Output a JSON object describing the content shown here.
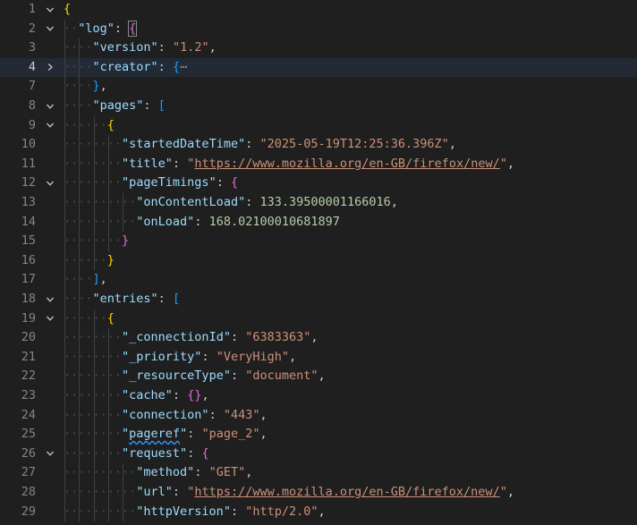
{
  "editor": {
    "lines": [
      {
        "num": "1",
        "fold": "down",
        "indent": 0,
        "parts": [
          {
            "t": "{",
            "c": "b1"
          }
        ]
      },
      {
        "num": "2",
        "fold": "down",
        "indent": 1,
        "parts": [
          {
            "t": "\"log\"",
            "c": "k"
          },
          {
            "t": ": ",
            "c": "p"
          },
          {
            "t": "{",
            "c": "b2",
            "box": true
          }
        ]
      },
      {
        "num": "3",
        "fold": "",
        "indent": 2,
        "parts": [
          {
            "t": "\"version\"",
            "c": "k"
          },
          {
            "t": ": ",
            "c": "p"
          },
          {
            "t": "\"1.2\"",
            "c": "s"
          },
          {
            "t": ",",
            "c": "p"
          }
        ]
      },
      {
        "num": "4",
        "fold": "right",
        "indent": 2,
        "current": true,
        "parts": [
          {
            "t": "\"creator\"",
            "c": "k"
          },
          {
            "t": ": ",
            "c": "p"
          },
          {
            "t": "{",
            "c": "b3"
          },
          {
            "t": "⋯",
            "c": "ellipsis"
          }
        ]
      },
      {
        "num": "7",
        "fold": "",
        "indent": 2,
        "parts": [
          {
            "t": "}",
            "c": "b3"
          },
          {
            "t": ",",
            "c": "p"
          }
        ]
      },
      {
        "num": "8",
        "fold": "down",
        "indent": 2,
        "parts": [
          {
            "t": "\"pages\"",
            "c": "k"
          },
          {
            "t": ": ",
            "c": "p"
          },
          {
            "t": "[",
            "c": "b3"
          }
        ]
      },
      {
        "num": "9",
        "fold": "down",
        "indent": 3,
        "parts": [
          {
            "t": "{",
            "c": "b1"
          }
        ]
      },
      {
        "num": "10",
        "fold": "",
        "indent": 4,
        "parts": [
          {
            "t": "\"startedDateTime\"",
            "c": "k"
          },
          {
            "t": ": ",
            "c": "p"
          },
          {
            "t": "\"2025-05-19T12:25:36.396Z\"",
            "c": "s"
          },
          {
            "t": ",",
            "c": "p"
          }
        ]
      },
      {
        "num": "11",
        "fold": "",
        "indent": 4,
        "parts": [
          {
            "t": "\"title\"",
            "c": "k"
          },
          {
            "t": ": ",
            "c": "p"
          },
          {
            "t": "\"",
            "c": "s"
          },
          {
            "t": "https://www.mozilla.org/en-GB/firefox/new/",
            "c": "s",
            "link": true
          },
          {
            "t": "\"",
            "c": "s"
          },
          {
            "t": ",",
            "c": "p"
          }
        ]
      },
      {
        "num": "12",
        "fold": "down",
        "indent": 4,
        "parts": [
          {
            "t": "\"pageTimings\"",
            "c": "k"
          },
          {
            "t": ": ",
            "c": "p"
          },
          {
            "t": "{",
            "c": "b2"
          }
        ]
      },
      {
        "num": "13",
        "fold": "",
        "indent": 5,
        "parts": [
          {
            "t": "\"onContentLoad\"",
            "c": "k"
          },
          {
            "t": ": ",
            "c": "p"
          },
          {
            "t": "133.39500001166016",
            "c": "n"
          },
          {
            "t": ",",
            "c": "p"
          }
        ]
      },
      {
        "num": "14",
        "fold": "",
        "indent": 5,
        "parts": [
          {
            "t": "\"onLoad\"",
            "c": "k"
          },
          {
            "t": ": ",
            "c": "p"
          },
          {
            "t": "168.02100010681897",
            "c": "n"
          }
        ]
      },
      {
        "num": "15",
        "fold": "",
        "indent": 4,
        "parts": [
          {
            "t": "}",
            "c": "b2"
          }
        ]
      },
      {
        "num": "16",
        "fold": "",
        "indent": 3,
        "parts": [
          {
            "t": "}",
            "c": "b1"
          }
        ]
      },
      {
        "num": "17",
        "fold": "",
        "indent": 2,
        "parts": [
          {
            "t": "]",
            "c": "b3"
          },
          {
            "t": ",",
            "c": "p"
          }
        ]
      },
      {
        "num": "18",
        "fold": "down",
        "indent": 2,
        "parts": [
          {
            "t": "\"entries\"",
            "c": "k"
          },
          {
            "t": ": ",
            "c": "p"
          },
          {
            "t": "[",
            "c": "b3"
          }
        ]
      },
      {
        "num": "19",
        "fold": "down",
        "indent": 3,
        "parts": [
          {
            "t": "{",
            "c": "b1"
          }
        ]
      },
      {
        "num": "20",
        "fold": "",
        "indent": 4,
        "parts": [
          {
            "t": "\"_connectionId\"",
            "c": "k"
          },
          {
            "t": ": ",
            "c": "p"
          },
          {
            "t": "\"6383363\"",
            "c": "s"
          },
          {
            "t": ",",
            "c": "p"
          }
        ]
      },
      {
        "num": "21",
        "fold": "",
        "indent": 4,
        "parts": [
          {
            "t": "\"_priority\"",
            "c": "k"
          },
          {
            "t": ": ",
            "c": "p"
          },
          {
            "t": "\"VeryHigh\"",
            "c": "s"
          },
          {
            "t": ",",
            "c": "p"
          }
        ]
      },
      {
        "num": "22",
        "fold": "",
        "indent": 4,
        "parts": [
          {
            "t": "\"_resourceType\"",
            "c": "k"
          },
          {
            "t": ": ",
            "c": "p"
          },
          {
            "t": "\"document\"",
            "c": "s"
          },
          {
            "t": ",",
            "c": "p"
          }
        ]
      },
      {
        "num": "23",
        "fold": "",
        "indent": 4,
        "parts": [
          {
            "t": "\"cache\"",
            "c": "k"
          },
          {
            "t": ": ",
            "c": "p"
          },
          {
            "t": "{}",
            "c": "b2"
          },
          {
            "t": ",",
            "c": "p"
          }
        ]
      },
      {
        "num": "24",
        "fold": "",
        "indent": 4,
        "parts": [
          {
            "t": "\"connection\"",
            "c": "k"
          },
          {
            "t": ": ",
            "c": "p"
          },
          {
            "t": "\"443\"",
            "c": "s"
          },
          {
            "t": ",",
            "c": "p"
          }
        ]
      },
      {
        "num": "25",
        "fold": "",
        "indent": 4,
        "parts": [
          {
            "t": "\"",
            "c": "k"
          },
          {
            "t": "pageref",
            "c": "k",
            "squiggle": true
          },
          {
            "t": "\"",
            "c": "k"
          },
          {
            "t": ": ",
            "c": "p"
          },
          {
            "t": "\"page_2\"",
            "c": "s"
          },
          {
            "t": ",",
            "c": "p"
          }
        ]
      },
      {
        "num": "26",
        "fold": "down",
        "indent": 4,
        "parts": [
          {
            "t": "\"request\"",
            "c": "k"
          },
          {
            "t": ": ",
            "c": "p"
          },
          {
            "t": "{",
            "c": "b2"
          }
        ]
      },
      {
        "num": "27",
        "fold": "",
        "indent": 5,
        "parts": [
          {
            "t": "\"method\"",
            "c": "k"
          },
          {
            "t": ": ",
            "c": "p"
          },
          {
            "t": "\"GET\"",
            "c": "s"
          },
          {
            "t": ",",
            "c": "p"
          }
        ]
      },
      {
        "num": "28",
        "fold": "",
        "indent": 5,
        "parts": [
          {
            "t": "\"url\"",
            "c": "k"
          },
          {
            "t": ": ",
            "c": "p"
          },
          {
            "t": "\"",
            "c": "s"
          },
          {
            "t": "https://www.mozilla.org/en-GB/firefox/new/",
            "c": "s",
            "link": true
          },
          {
            "t": "\"",
            "c": "s"
          },
          {
            "t": ",",
            "c": "p"
          }
        ]
      },
      {
        "num": "29",
        "fold": "",
        "indent": 5,
        "parts": [
          {
            "t": "\"httpVersion\"",
            "c": "k"
          },
          {
            "t": ": ",
            "c": "p"
          },
          {
            "t": "\"http/2.0\"",
            "c": "s"
          },
          {
            "t": ",",
            "c": "p"
          }
        ]
      }
    ]
  }
}
